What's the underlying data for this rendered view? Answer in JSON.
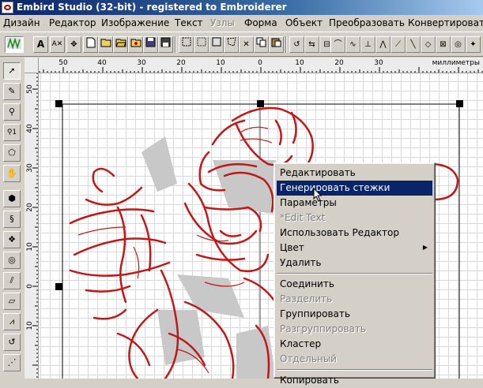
{
  "window": {
    "title": "Embird Studio (32-bit)  - registered to Embroiderer"
  },
  "menu": [
    "Дизайн",
    "Редактор",
    "Изображение",
    "Текст",
    "Узлы",
    "Форма",
    "Объект",
    "Преобразовать",
    "Конвертировать"
  ],
  "menu_disabled": [
    "Узлы"
  ],
  "ruler": {
    "units": "миллиметры",
    "h_labels": [
      "50",
      "40",
      "30",
      "20",
      "10",
      "0",
      "10",
      "20",
      "30"
    ],
    "v_labels": [
      "50",
      "40",
      "30",
      "20",
      "10",
      "0",
      "10"
    ]
  },
  "context_menu": {
    "items": [
      {
        "label": "Редактировать",
        "state": "normal"
      },
      {
        "label": "Генерировать стежки",
        "state": "highlighted"
      },
      {
        "label": "Параметры",
        "state": "normal"
      },
      {
        "label": "*Edit Text",
        "state": "disabled"
      },
      {
        "label": "Использовать Редактор",
        "state": "normal"
      },
      {
        "label": "Цвет",
        "state": "normal",
        "submenu": "▶"
      },
      {
        "label": "Удалить",
        "state": "normal"
      },
      {
        "label": "Соединить",
        "state": "normal"
      },
      {
        "label": "Разделить",
        "state": "disabled"
      },
      {
        "label": "Группировать",
        "state": "normal"
      },
      {
        "label": "Разгруппировать",
        "state": "disabled"
      },
      {
        "label": "Кластер",
        "state": "normal"
      },
      {
        "label": "Отдельный",
        "state": "disabled"
      },
      {
        "label": "Копировать",
        "state": "normal"
      }
    ]
  },
  "colors": {
    "accent": "#0a246a",
    "stitch": "#c01818",
    "fill": "#c8c8c8"
  },
  "icons": {
    "left_tools": [
      "pointer-icon",
      "node-edit-icon",
      "zoom-icon",
      "zoom-point-icon",
      "polygon-icon",
      "hand-icon",
      "fill-shape-icon",
      "satin-icon",
      "layers-icon",
      "circle-icon",
      "column-icon",
      "parallelogram-icon",
      "zigzag-icon",
      "curve-icon",
      "pattern-icon"
    ],
    "toolbar": [
      "stitch-mode-icon",
      "text-icon",
      "text-node-icon",
      "move-icon",
      "new-file-icon",
      "open-icon",
      "open-folder-icon",
      "open-design-icon",
      "save-icon",
      "select-rect-icon",
      "select-dash-icon",
      "select-poly-icon",
      "select-lasso-icon",
      "select-all-icon",
      "delete-icon",
      "copy-icon",
      "paste-icon",
      "rotate-icon",
      "flip-icon",
      "align-icon",
      "node-tool-icon",
      "curve-tool-icon",
      "break-icon",
      "join-icon",
      "knife-icon",
      "line-tool-icon",
      "shape-tool-icon",
      "convert-icon",
      "grid-icon",
      "snap-icon",
      "settings-icon"
    ]
  }
}
